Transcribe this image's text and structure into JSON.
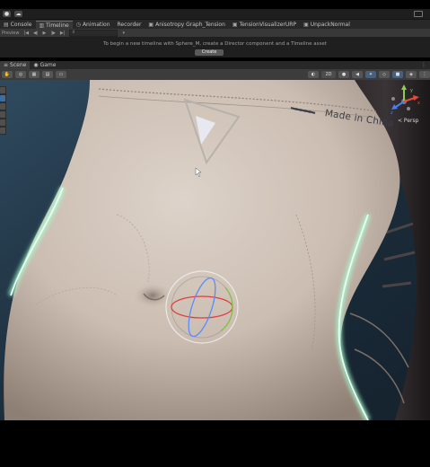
{
  "toolbar": {
    "buttons": [
      "",
      "",
      ""
    ]
  },
  "tabs": [
    {
      "label": "Console",
      "icon": "console-icon",
      "active": false
    },
    {
      "label": "Timeline",
      "icon": "timeline-icon",
      "active": true
    },
    {
      "label": "Animation",
      "icon": "animation-icon",
      "active": false
    },
    {
      "label": "Recorder",
      "icon": "recorder-icon",
      "active": false
    },
    {
      "label": "Anisotropy Graph_Tension",
      "icon": "shader-graph-icon",
      "active": false
    },
    {
      "label": "TensionVisualizerURP",
      "icon": "shader-graph-icon",
      "active": false
    },
    {
      "label": "UnpackNormal",
      "icon": "shader-graph-icon",
      "active": false
    }
  ],
  "timeline": {
    "preview_label": "Preview",
    "frame_value": "0",
    "message": "To begin a new timeline with Sphere_M, create a Director component and a Timeline asset",
    "create_button": "Create"
  },
  "view_tabs": [
    {
      "label": "Scene",
      "icon": "scene-icon",
      "active": true
    },
    {
      "label": "Game",
      "icon": "game-icon",
      "active": false
    }
  ],
  "scene_toolbar": {
    "mode_2d": "2D"
  },
  "scene": {
    "garment_label": "Made in China",
    "gizmo_projection": "< Persp",
    "gizmo_axes": {
      "x": "x",
      "y": "y",
      "z": "z"
    }
  },
  "colors": {
    "accent": "#3a79bb",
    "fabric": "#d4c8bd",
    "rim_light": "#b8ffd8",
    "background": "#1d2d3a"
  }
}
